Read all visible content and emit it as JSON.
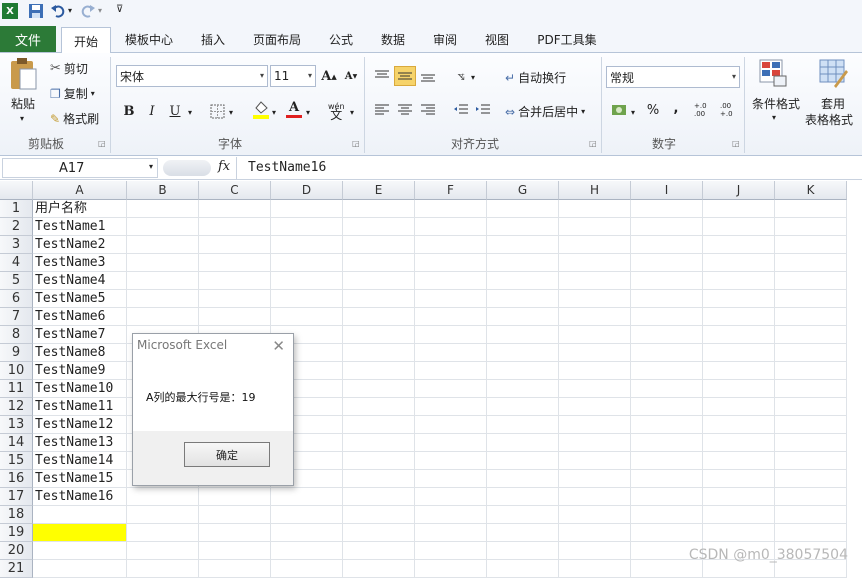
{
  "quick_access": {
    "excel_icon": "excel-logo-icon",
    "save_icon": "save-icon",
    "undo_icon": "undo-icon",
    "redo_icon": "redo-icon",
    "customize_icon": "customize-icon"
  },
  "tabs": [
    {
      "label": "文件"
    },
    {
      "label": "开始"
    },
    {
      "label": "模板中心"
    },
    {
      "label": "插入"
    },
    {
      "label": "页面布局"
    },
    {
      "label": "公式"
    },
    {
      "label": "数据"
    },
    {
      "label": "审阅"
    },
    {
      "label": "视图"
    },
    {
      "label": "PDF工具集"
    }
  ],
  "ribbon": {
    "clipboard": {
      "paste": "粘贴",
      "cut": "剪切",
      "copy": "复制",
      "format_painter": "格式刷",
      "group": "剪贴板"
    },
    "font": {
      "name": "宋体",
      "size": "11",
      "bold": "B",
      "italic": "I",
      "underline": "U",
      "grow": "A",
      "shrink": "A",
      "font_color_glyph": "A",
      "wen": "wén",
      "wen2": "文",
      "group": "字体"
    },
    "alignment": {
      "wrap": "自动换行",
      "merge": "合并后居中",
      "group": "对齐方式"
    },
    "number": {
      "format": "常规",
      "percent": "%",
      "comma": ",",
      "inc": "+.0 .00",
      "dec": ".00 +.0",
      "group": "数字"
    },
    "styles": {
      "conditional": "条件格式",
      "table_line1": "套用",
      "table_line2": "表格格式"
    }
  },
  "formula_bar": {
    "name_box": "A17",
    "fx": "fx",
    "content": "TestName16"
  },
  "columns": [
    "A",
    "B",
    "C",
    "D",
    "E",
    "F",
    "G",
    "H",
    "I",
    "J",
    "K"
  ],
  "rows": [
    "1",
    "2",
    "3",
    "4",
    "5",
    "6",
    "7",
    "8",
    "9",
    "10",
    "11",
    "12",
    "13",
    "14",
    "15",
    "16",
    "17",
    "18",
    "19",
    "20",
    "21"
  ],
  "cells_a": [
    "用户名称",
    "TestName1",
    "TestName2",
    "TestName3",
    "TestName4",
    "TestName5",
    "TestName6",
    "TestName7",
    "TestName8",
    "TestName9",
    "TestName10",
    "TestName11",
    "TestName12",
    "TestName13",
    "TestName14",
    "TestName15",
    "TestName16",
    "",
    "",
    "",
    ""
  ],
  "highlight": {
    "cell": "A19",
    "color": "#ffff00"
  },
  "dialog": {
    "title": "Microsoft Excel",
    "close": "✕",
    "message": "A列的最大行号是：19",
    "ok": "确定"
  },
  "watermark": "CSDN @m0_38057504",
  "colors": {
    "file_tab": "#2c7a37",
    "accent": "#f6d36a"
  }
}
